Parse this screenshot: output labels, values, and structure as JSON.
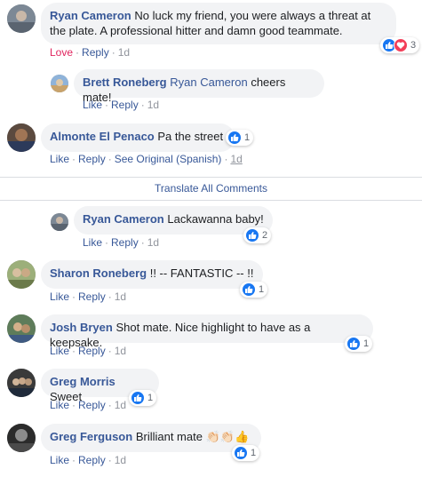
{
  "comments": [
    {
      "name": "Ryan Cameron",
      "text": "No luck my friend, you were always a threat at the plate. A professional hitter and damn good teammate.",
      "reaction_action": "Love",
      "reply": "Reply",
      "time": "1d",
      "reaction_count": "3"
    },
    {
      "name": "Brett Roneberg",
      "mention": "Ryan Cameron",
      "text": "cheers mate!",
      "like": "Like",
      "reply": "Reply",
      "time": "1d"
    },
    {
      "name": "Almonte El Penaco",
      "text": "Pa the street",
      "like": "Like",
      "reply": "Reply",
      "see_original": "See Original (Spanish)",
      "time": "1d",
      "reaction_count": "1"
    },
    {
      "name": "Ryan Cameron",
      "text": "Lackawanna baby!",
      "like": "Like",
      "reply": "Reply",
      "time": "1d",
      "reaction_count": "2"
    },
    {
      "name": "Sharon Roneberg",
      "text": "!! -- FANTASTIC -- !!",
      "like": "Like",
      "reply": "Reply",
      "time": "1d",
      "reaction_count": "1"
    },
    {
      "name": "Josh Bryen",
      "text": "Shot mate. Nice highlight to have as a keepsake.",
      "like": "Like",
      "reply": "Reply",
      "time": "1d",
      "reaction_count": "1"
    },
    {
      "name": "Greg Morris",
      "text": "Sweet",
      "like": "Like",
      "reply": "Reply",
      "time": "1d",
      "reaction_count": "1"
    },
    {
      "name": "Greg Ferguson",
      "text": "Brilliant mate",
      "emoji": "👏🏻👏🏻👍",
      "like": "Like",
      "reply": "Reply",
      "time": "1d",
      "reaction_count": "1"
    }
  ],
  "translate_all": "Translate All Comments",
  "separator": "·",
  "colors": {
    "link": "#385898",
    "bubble": "#f2f3f5",
    "like_blue": "#1877f2",
    "love_red": "#e0245e"
  },
  "icons": [
    "like-reaction-icon",
    "love-reaction-icon",
    "avatar"
  ]
}
